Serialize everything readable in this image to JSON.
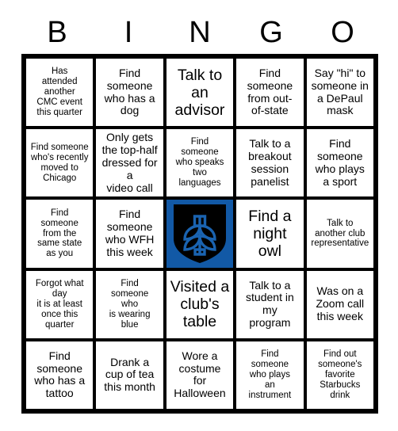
{
  "header": {
    "letters": [
      "B",
      "I",
      "N",
      "G",
      "O"
    ]
  },
  "colors": {
    "accent_blue": "#1259a6",
    "grid_line": "#000000",
    "cell_background": "#ffffff",
    "text": "#000000"
  },
  "grid": {
    "columns": 5,
    "rows": 5,
    "cells": [
      {
        "text": "Has\nattended\nanother\nCMC event\nthis quarter",
        "size": "sm",
        "type": "text"
      },
      {
        "text": "Find\nsomeone\nwho has a\ndog",
        "size": "md",
        "type": "text"
      },
      {
        "text": "Talk to\nan\nadvisor",
        "size": "lg",
        "type": "text"
      },
      {
        "text": "Find\nsomeone\nfrom out-\nof-state",
        "size": "md",
        "type": "text"
      },
      {
        "text": "Say \"hi\" to\nsomeone in\na DePaul\nmask",
        "size": "md",
        "type": "text"
      },
      {
        "text": "Find someone\nwho's recently\nmoved to\nChicago",
        "size": "sm",
        "type": "text"
      },
      {
        "text": "Only gets\nthe top-half\ndressed for a\nvideo call",
        "size": "md",
        "type": "text"
      },
      {
        "text": "Find\nsomeone\nwho speaks\ntwo\nlanguages",
        "size": "sm",
        "type": "text"
      },
      {
        "text": "Talk to a\nbreakout\nsession\npanelist",
        "size": "md",
        "type": "text"
      },
      {
        "text": "Find\nsomeone\nwho plays\na sport",
        "size": "md",
        "type": "text"
      },
      {
        "text": "Find\nsomeone\nfrom the\nsame state\nas you",
        "size": "sm",
        "type": "text"
      },
      {
        "text": "Find\nsomeone\nwho WFH\nthis week",
        "size": "md",
        "type": "text"
      },
      {
        "text": "",
        "size": "md",
        "type": "logo",
        "logo_name": "depaul-shield-logo"
      },
      {
        "text": "Find a\nnight\nowl",
        "size": "lg",
        "type": "text"
      },
      {
        "text": "Talk to\nanother club\nrepresentative",
        "size": "sm",
        "type": "text"
      },
      {
        "text": "Forgot what\nday\nit is at least\nonce this\nquarter",
        "size": "sm",
        "type": "text"
      },
      {
        "text": "Find\nsomeone\nwho\nis wearing\nblue",
        "size": "sm",
        "type": "text"
      },
      {
        "text": "Visited a\nclub's\ntable",
        "size": "lg",
        "type": "text"
      },
      {
        "text": "Talk to a\nstudent in\nmy\nprogram",
        "size": "md",
        "type": "text"
      },
      {
        "text": "Was on a\nZoom call\nthis week",
        "size": "md",
        "type": "text"
      },
      {
        "text": "Find\nsomeone\nwho has a\ntattoo",
        "size": "md",
        "type": "text"
      },
      {
        "text": "Drank a\ncup of tea\nthis month",
        "size": "md",
        "type": "text"
      },
      {
        "text": "Wore a\ncostume\nfor\nHalloween",
        "size": "md",
        "type": "text"
      },
      {
        "text": "Find\nsomeone\nwho plays\nan\ninstrument",
        "size": "sm",
        "type": "text"
      },
      {
        "text": "Find out\nsomeone's\nfavorite\nStarbucks\ndrink",
        "size": "sm",
        "type": "text"
      }
    ]
  }
}
